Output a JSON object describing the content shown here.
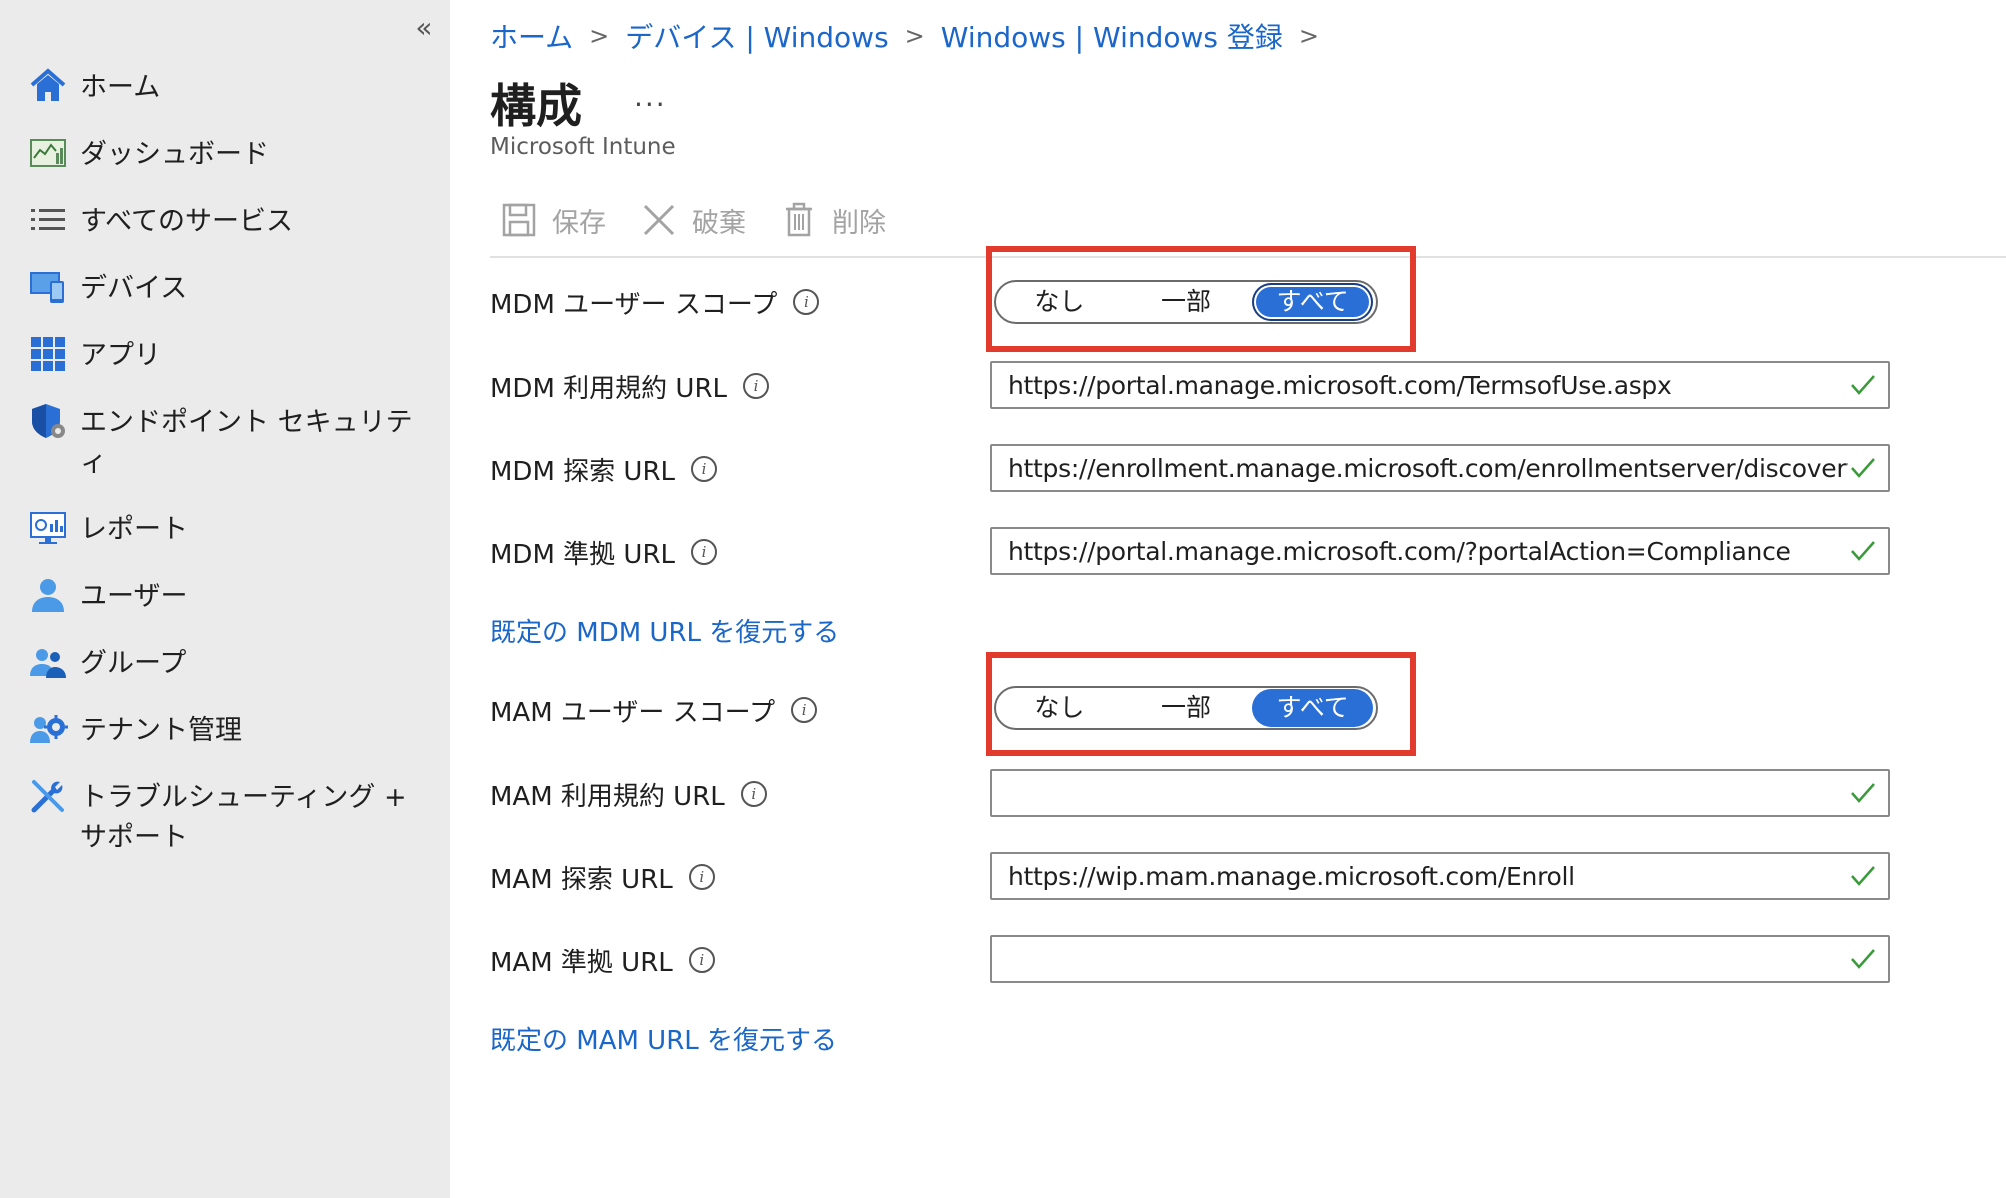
{
  "sidebar": {
    "collapse_glyph": "«",
    "items": [
      {
        "label": "ホーム",
        "icon": "home-icon"
      },
      {
        "label": "ダッシュボード",
        "icon": "dashboard-icon"
      },
      {
        "label": "すべてのサービス",
        "icon": "list-icon"
      },
      {
        "label": "デバイス",
        "icon": "devices-icon"
      },
      {
        "label": "アプリ",
        "icon": "apps-grid-icon"
      },
      {
        "label": "エンドポイント セキュリティ",
        "icon": "shield-icon"
      },
      {
        "label": "レポート",
        "icon": "reports-icon"
      },
      {
        "label": "ユーザー",
        "icon": "user-icon"
      },
      {
        "label": "グループ",
        "icon": "group-icon"
      },
      {
        "label": "テナント管理",
        "icon": "tenant-admin-icon"
      },
      {
        "label": "トラブルシューティング + サポート",
        "icon": "wrench-icon"
      }
    ]
  },
  "breadcrumb": [
    "ホーム",
    "デバイス | Windows",
    "Windows | Windows 登録"
  ],
  "breadcrumb_sep": ">",
  "page": {
    "title": "構成",
    "more": "...",
    "subtitle": "Microsoft Intune"
  },
  "toolbar": {
    "save": "保存",
    "discard": "破棄",
    "delete": "削除"
  },
  "toggle_options": [
    "なし",
    "一部",
    "すべて"
  ],
  "mdm": {
    "scope_label": "MDM ユーザー スコープ",
    "scope_value": "すべて",
    "terms_label": "MDM 利用規約 URL",
    "terms_value": "https://portal.manage.microsoft.com/TermsofUse.aspx",
    "discovery_label": "MDM 探索 URL",
    "discovery_value": "https://enrollment.manage.microsoft.com/enrollmentserver/discovery.svc",
    "compliance_label": "MDM 準拠 URL",
    "compliance_value": "https://portal.manage.microsoft.com/?portalAction=Compliance",
    "restore_link": "既定の MDM URL を復元する"
  },
  "mam": {
    "scope_label": "MAM ユーザー スコープ",
    "scope_value": "すべて",
    "terms_label": "MAM 利用規約 URL",
    "terms_value": "",
    "discovery_label": "MAM 探索 URL",
    "discovery_value": "https://wip.mam.manage.microsoft.com/Enroll",
    "compliance_label": "MAM 準拠 URL",
    "compliance_value": "",
    "restore_link": "既定の MAM URL を復元する"
  },
  "info_glyph": "i",
  "colors": {
    "accent": "#2a6fd6",
    "link": "#1a66c9",
    "highlight": "#e23b2e",
    "check": "#3a9a3a",
    "sidebar_bg": "#ebebeb"
  }
}
